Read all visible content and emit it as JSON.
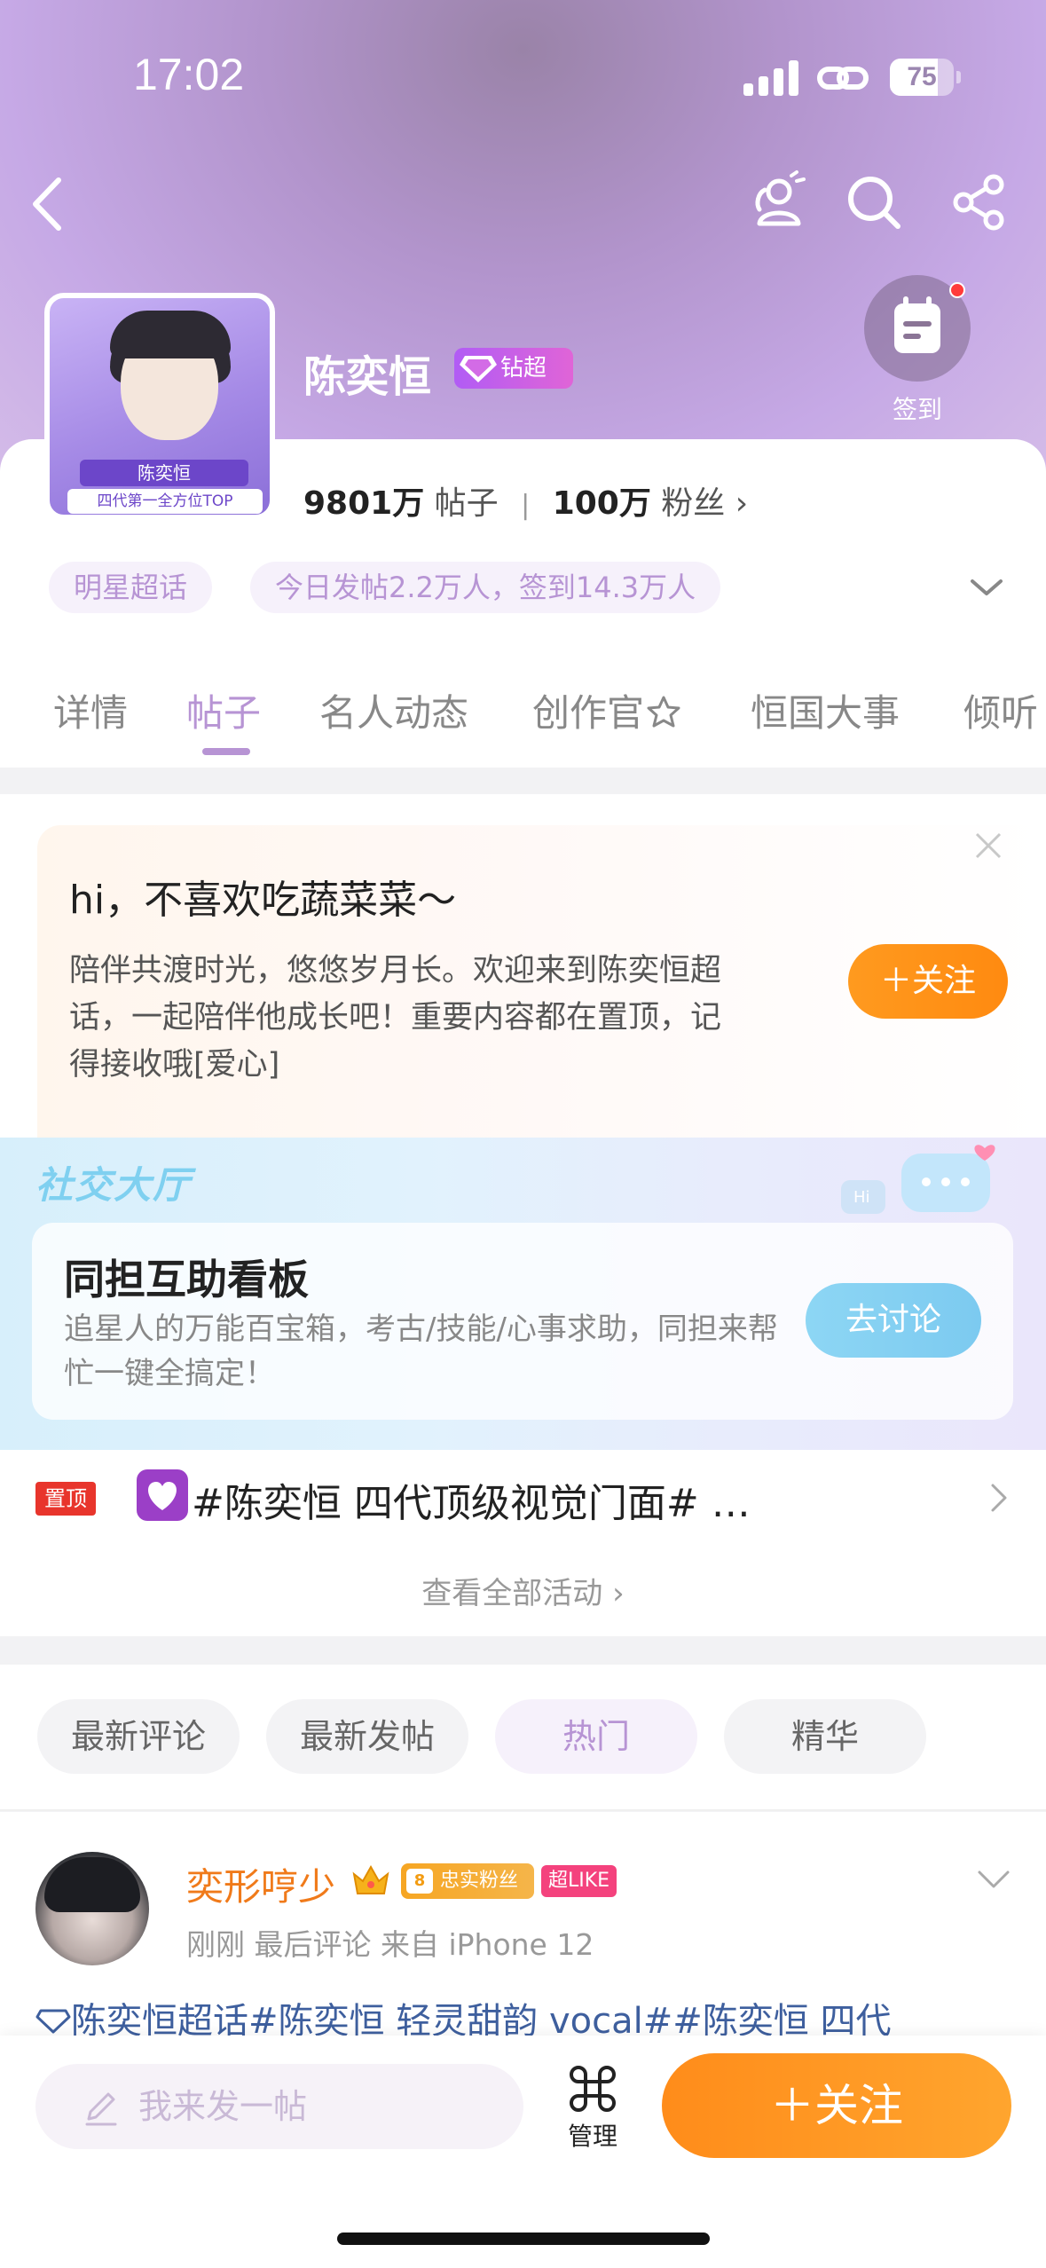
{
  "status_bar": {
    "time": "17:02",
    "battery": "75",
    "battery_level": 0.75
  },
  "header": {
    "topic_name": "陈奕恒",
    "badge_label": "钻超",
    "checkin_label": "签到",
    "avatar_banner": "陈奕恒",
    "avatar_banner2": "四代第一全方位TOP"
  },
  "stats": {
    "posts_count": "9801万",
    "posts_label": "帖子",
    "fans_count": "100万",
    "fans_label": "粉丝"
  },
  "chips": {
    "category": "明星超话",
    "today": "今日发帖2.2万人，签到14.3万人"
  },
  "tabs": [
    "详情",
    "帖子",
    "名人动态",
    "创作官",
    "恒国大事",
    "倾听"
  ],
  "welcome": {
    "title": "hi，不喜欢吃蔬菜菜～",
    "text": "陪伴共渡时光，悠悠岁月长。欢迎来到陈奕恒超话，一起陪伴他成长吧！重要内容都在置顶，记得接收哦[爱心]",
    "follow_label": "＋关注"
  },
  "hall": {
    "title": "社交大厅",
    "card_title": "同担互助看板",
    "card_text": "追星人的万能百宝箱，考古/技能/心事求助，同担来帮忙一键全搞定！",
    "button_label": "去讨论"
  },
  "pinned": {
    "tag": "置顶",
    "text": "#陈奕恒 四代顶级视觉门面# …",
    "see_all": "查看全部活动 ›"
  },
  "filters": [
    "最新评论",
    "最新发帖",
    "热门",
    "精华"
  ],
  "post": {
    "user_name": "奕形哼少",
    "fan_badge_level": "8",
    "fan_badge": "忠实粉丝",
    "like_badge": "超LIKE",
    "meta": "刚刚  最后评论   来自 iPhone 12",
    "text": "陈奕恒超话#陈奕恒 轻灵甜韵 vocal##陈奕恒 四代"
  },
  "bottom": {
    "compose_placeholder": "我来发一帖",
    "manage_label": "管理",
    "follow_label": "＋关注"
  },
  "colors": {
    "accent_purple": "#b794d4",
    "follow_orange": "#ff9a1f",
    "hashtag_blue": "#3e5f9e",
    "username_orange": "#f07a1a"
  }
}
